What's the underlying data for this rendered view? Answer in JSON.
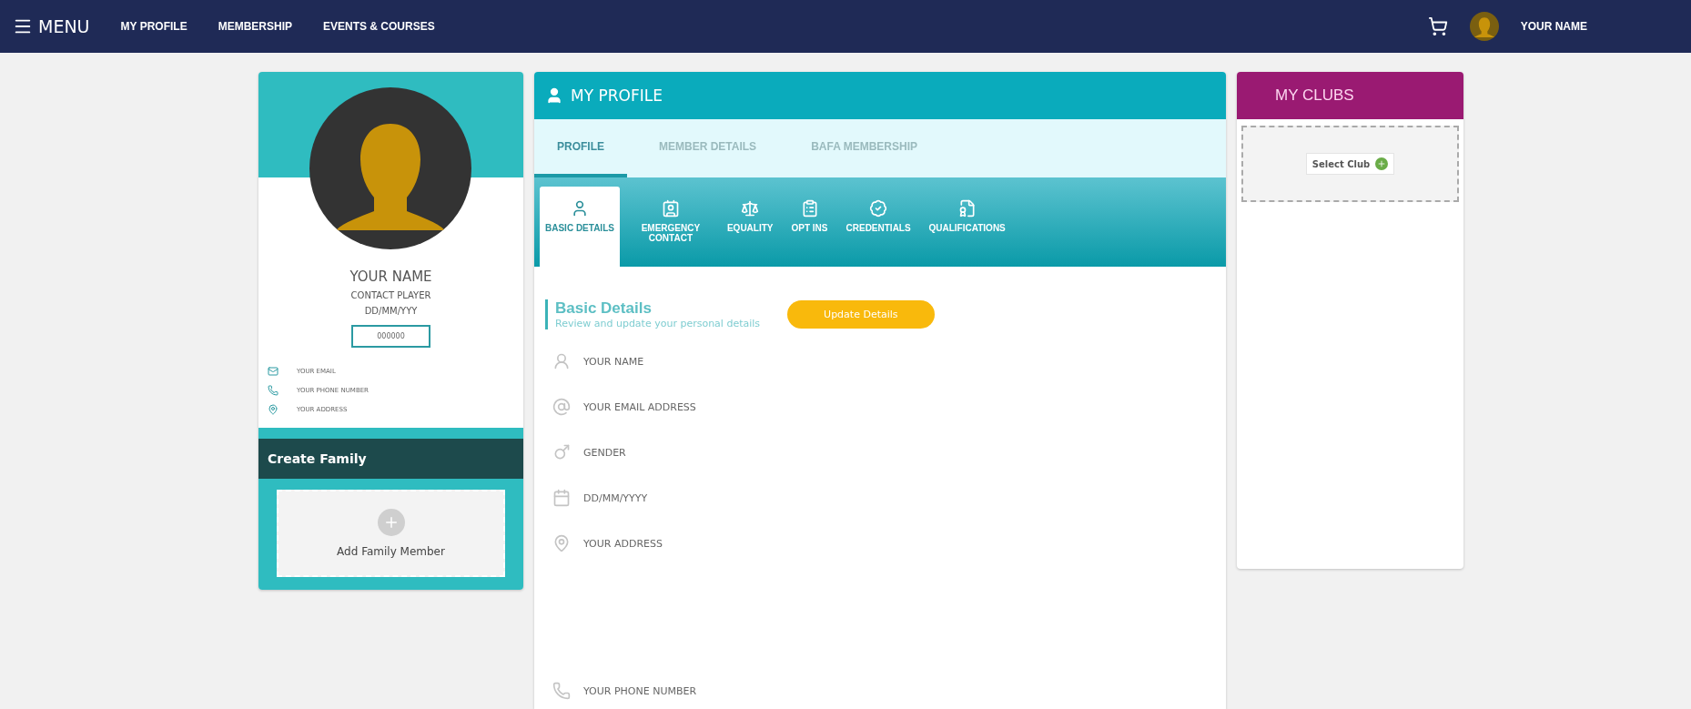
{
  "nav": {
    "menu_label": "MENU",
    "items": [
      {
        "label": "MY PROFILE"
      },
      {
        "label": "MEMBERSHIP"
      },
      {
        "label": "EVENTS & COURSES"
      }
    ],
    "user_name": "YOUR NAME"
  },
  "profile_card": {
    "name": "YOUR NAME",
    "role": "CONTACT PLAYER",
    "dob": "DD/MM/YYY",
    "id_box": "000000",
    "contacts": [
      {
        "kind": "email",
        "text": "YOUR EMAIL"
      },
      {
        "kind": "phone",
        "text": "YOUR PHONE NUMBER"
      },
      {
        "kind": "address",
        "text": "YOUR ADDRESS"
      }
    ],
    "family_title": "Create Family",
    "add_label": "Add Family Member"
  },
  "main": {
    "title": "MY PROFILE",
    "tabs": [
      {
        "label": "PROFILE",
        "selected": true
      },
      {
        "label": "MEMBER DETAILS",
        "selected": false
      },
      {
        "label": "BAFA MEMBERSHIP",
        "selected": false
      }
    ],
    "subtabs": [
      {
        "kind": "basic",
        "label": "BASIC DETAILS",
        "selected": true
      },
      {
        "kind": "emergency",
        "label": "EMERGENCY CONTACT",
        "selected": false
      },
      {
        "kind": "equality",
        "label": "EQUALITY",
        "selected": false
      },
      {
        "kind": "optins",
        "label": "OPT INS",
        "selected": false
      },
      {
        "kind": "credentials",
        "label": "CREDENTIALS",
        "selected": false
      },
      {
        "kind": "qualifications",
        "label": "QUALIFICATIONS",
        "selected": false
      }
    ],
    "section_title": "Basic Details",
    "section_subtitle": "Review and update your personal details",
    "update_button": "Update Details",
    "fields": [
      {
        "kind": "name",
        "text": "YOUR NAME"
      },
      {
        "kind": "email",
        "text": "YOUR EMAIL ADDRESS"
      },
      {
        "kind": "gender",
        "text": "GENDER"
      },
      {
        "kind": "date",
        "text": "DD/MM/YYYY"
      },
      {
        "kind": "address",
        "text": "YOUR ADDRESS"
      },
      {
        "kind": "phone",
        "text": "YOUR PHONE NUMBER"
      }
    ]
  },
  "clubs": {
    "title": "MY CLUBS",
    "select_label": "Select Club"
  }
}
